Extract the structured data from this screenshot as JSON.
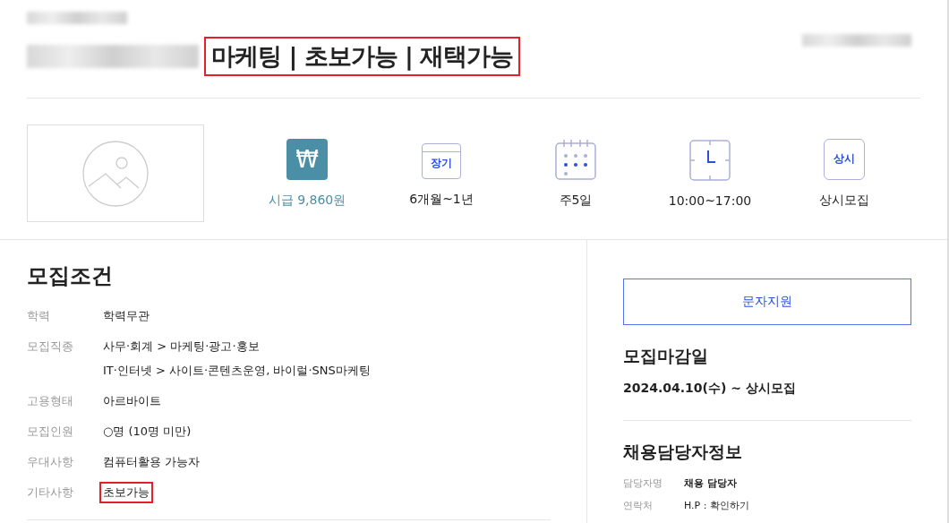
{
  "header": {
    "title": "마케팅 | 초보가능 | 재택가능",
    "title_highlighted": true
  },
  "summary": [
    {
      "kind": "wage",
      "icon_text": "₩",
      "label": "시급 9,860원"
    },
    {
      "kind": "calendar_label",
      "icon_text": "장기",
      "label": "6개월~1년"
    },
    {
      "kind": "calendar_dots",
      "label": "주5일"
    },
    {
      "kind": "clock",
      "label": "10:00~17:00"
    },
    {
      "kind": "badge",
      "icon_text": "상시",
      "label": "상시모집"
    }
  ],
  "conditions": {
    "title": "모집조건",
    "rows": [
      {
        "label": "학력",
        "values": [
          "학력무관"
        ],
        "highlighted": false
      },
      {
        "label": "모집직종",
        "values": [
          "사무·회계 > 마케팅·광고·홍보",
          "IT·인터넷 > 사이트·콘텐츠운영, 바이럴·SNS마케팅"
        ],
        "highlighted": false
      },
      {
        "label": "고용형태",
        "values": [
          "아르바이트"
        ],
        "highlighted": false
      },
      {
        "label": "모집인원",
        "values": [
          "○명 (10명 미만)"
        ],
        "highlighted": false
      },
      {
        "label": "우대사항",
        "values": [
          "컴퓨터활용 가능자"
        ],
        "highlighted": false
      },
      {
        "label": "기타사항",
        "values": [
          "초보가능"
        ],
        "highlighted": true
      }
    ]
  },
  "sidebar": {
    "apply_button": "문자지원",
    "deadline_title": "모집마감일",
    "deadline": "2024.04.10(수) ~ 상시모집",
    "contact_title": "채용담당자정보",
    "contact_rows": [
      {
        "label": "담당자명",
        "value": "채용 담당자",
        "bold": true
      },
      {
        "label": "연락처",
        "value": "H.P : 확인하기",
        "bold": false
      }
    ]
  }
}
